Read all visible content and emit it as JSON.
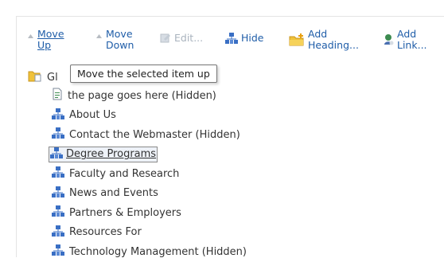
{
  "toolbar": {
    "move_up": "Move\nUp",
    "move_up_line1": "Move",
    "move_up_line2": "Up",
    "move_down_line1": "Move",
    "move_down_line2": "Down",
    "edit": "Edit...",
    "hide": "Hide",
    "add_heading_line1": "Add",
    "add_heading_line2": "Heading...",
    "add_link_line1": "Add",
    "add_link_line2": "Link..."
  },
  "tooltip": "Move the selected item up",
  "tree": {
    "root_label": "Gl",
    "items": [
      {
        "label": "the page goes here (Hidden)",
        "icon": "page-icon"
      },
      {
        "label": "About Us",
        "icon": "sitemap-icon"
      },
      {
        "label": "Contact the Webmaster (Hidden)",
        "icon": "sitemap-icon"
      },
      {
        "label": "Degree Programs",
        "icon": "sitemap-icon",
        "selected": true
      },
      {
        "label": "Faculty and Research",
        "icon": "sitemap-icon"
      },
      {
        "label": "News and Events",
        "icon": "sitemap-icon"
      },
      {
        "label": "Partners & Employers",
        "icon": "sitemap-icon"
      },
      {
        "label": "Resources For",
        "icon": "sitemap-icon"
      },
      {
        "label": "Technology Management (Hidden)",
        "icon": "sitemap-icon"
      }
    ]
  },
  "colors": {
    "link": "#1f5da8",
    "disabled": "#a9b3be",
    "icon_blue": "#3a6fc4"
  }
}
